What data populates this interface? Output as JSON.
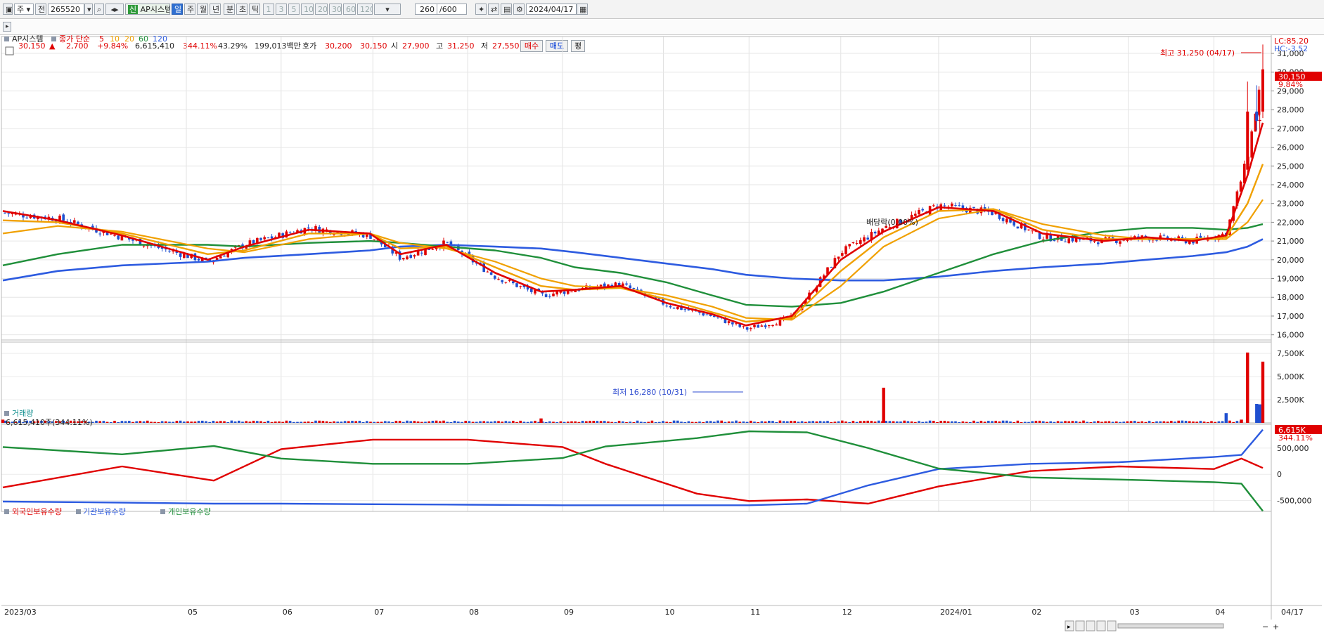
{
  "toolbar": {
    "market": "주",
    "jeon": "전",
    "code": "265520",
    "new_badge": "신",
    "stock_name": "AP시스템",
    "periods": [
      "일",
      "주",
      "월",
      "년",
      "분",
      "초",
      "틱"
    ],
    "active_period": "일",
    "intervals": [
      "1",
      "3",
      "5",
      "10",
      "20",
      "30",
      "60",
      "120"
    ],
    "count": "260",
    "count_total": "/600",
    "date": "2024/04/17"
  },
  "quote": {
    "price": "30,150",
    "arrow": "▲",
    "change": "2,700",
    "rate": "+9.84%",
    "volume": "6,615,410",
    "vol_ratio": "344.11%",
    "turnover": "43.29%",
    "amount": "199,013백만",
    "hoga_label": "호가",
    "ask": "30,200",
    "bid": "30,150",
    "open_label": "시",
    "open": "27,900",
    "high_label": "고",
    "high": "31,250",
    "low_label": "저",
    "low": "27,550",
    "buy_label": "매수",
    "sell_label": "매도",
    "pyeong_label": "평"
  },
  "price_panel": {
    "title": "AP시스템",
    "ma_label": "종가 단순",
    "ma_periods": [
      "5",
      "10",
      "20",
      "60",
      "120"
    ],
    "ma_colors": [
      "#e00000",
      "#f0a000",
      "#f0a000",
      "#1f8f3a",
      "#2d5be0"
    ],
    "lc": "LC:85.20",
    "hc": "HC:-3.52",
    "last_price": "30,150",
    "last_rate": "9.84%",
    "max_note": "최고 31,250 (04/17)",
    "min_note": "최저 16,280 (10/31)",
    "dividend_note": "배당락(0.00%)",
    "y_ticks": [
      "31,000",
      "30,000",
      "29,000",
      "28,000",
      "27,000",
      "26,000",
      "25,000",
      "24,000",
      "23,000",
      "22,000",
      "21,000",
      "20,000",
      "19,000",
      "18,000",
      "17,000",
      "16,000"
    ]
  },
  "volume_panel": {
    "title": "거래량",
    "info": "6,615,410주(344.11%)",
    "last_value": "6,615K",
    "last_rate": "344.11%",
    "y_ticks": [
      "7,500K",
      "5,000K",
      "2,500K"
    ]
  },
  "holdings_panel": {
    "legend": [
      "외국인보유수량",
      "기관보유수량",
      "개인보유수량"
    ],
    "colors": [
      "#e00000",
      "#2d5be0",
      "#1f8f3a"
    ],
    "y_ticks": [
      "500,000",
      "0",
      "-500,000"
    ]
  },
  "x_axis": {
    "labels": [
      "2023/03",
      "05",
      "06",
      "07",
      "08",
      "09",
      "10",
      "11",
      "12",
      "2024/01",
      "02",
      "03",
      "04",
      "04/17"
    ]
  },
  "chart_data": [
    {
      "type": "line",
      "title": "AP시스템",
      "x_range": [
        "2023/03",
        "2024/04/17"
      ],
      "ylim": [
        15800,
        31300
      ],
      "close_price_points": {
        "x": [
          "2023/03/02",
          "2023/03/20",
          "2023/04/10",
          "2023/05/08",
          "2023/05/20",
          "2023/06/10",
          "2023/06/30",
          "2023/07/10",
          "2023/07/25",
          "2023/08/10",
          "2023/08/25",
          "2023/09/05",
          "2023/09/20",
          "2023/10/05",
          "2023/10/20",
          "2023/10/31",
          "2023/11/15",
          "2023/12/01",
          "2023/12/15",
          "2024/01/02",
          "2024/01/20",
          "2024/02/05",
          "2024/02/25",
          "2024/03/10",
          "2024/03/25",
          "2024/04/05",
          "2024/04/12",
          "2024/04/17"
        ],
        "values": [
          22500,
          22200,
          21200,
          19900,
          20800,
          21700,
          21300,
          20100,
          20900,
          19100,
          18100,
          18400,
          18700,
          17600,
          17000,
          16300,
          16900,
          20400,
          21700,
          22900,
          22500,
          21200,
          21000,
          21200,
          21000,
          21400,
          25500,
          30150
        ]
      },
      "series": [
        {
          "name": "5",
          "values": [
            22600,
            22100,
            21300,
            20000,
            20700,
            21600,
            21400,
            20300,
            20800,
            19300,
            18300,
            18400,
            18600,
            17700,
            17100,
            16500,
            17000,
            20000,
            21500,
            22800,
            22600,
            21400,
            21000,
            21200,
            21000,
            21300,
            24500,
            27300
          ]
        },
        {
          "name": "10",
          "values": [
            22100,
            22000,
            21400,
            20300,
            20500,
            21400,
            21400,
            20600,
            20700,
            19600,
            18600,
            18400,
            18500,
            17900,
            17200,
            16700,
            16900,
            19400,
            21200,
            22600,
            22700,
            21600,
            21100,
            21100,
            21100,
            21200,
            23000,
            25100
          ]
        },
        {
          "name": "20",
          "values": [
            21400,
            21800,
            21500,
            20600,
            20400,
            21100,
            21400,
            20900,
            20600,
            19900,
            19000,
            18600,
            18500,
            18100,
            17500,
            16900,
            16800,
            18600,
            20700,
            22200,
            22700,
            21900,
            21300,
            21100,
            21100,
            21100,
            22000,
            23200
          ]
        },
        {
          "name": "60",
          "values": [
            19700,
            20300,
            20800,
            20800,
            20700,
            20900,
            21000,
            20900,
            20700,
            20500,
            20100,
            19600,
            19300,
            18800,
            18100,
            17600,
            17500,
            17700,
            18300,
            19300,
            20300,
            21000,
            21500,
            21700,
            21700,
            21600,
            21700,
            21900
          ]
        },
        {
          "name": "120",
          "values": [
            18900,
            19400,
            19700,
            19900,
            20100,
            20300,
            20500,
            20700,
            20800,
            20700,
            20600,
            20400,
            20100,
            19800,
            19500,
            19200,
            19000,
            18900,
            18900,
            19100,
            19400,
            19600,
            19800,
            20000,
            20200,
            20400,
            20700,
            21100
          ]
        }
      ],
      "annotations": {
        "high": 31250,
        "high_date": "04/17",
        "low": 16280,
        "low_date": "10/31"
      }
    },
    {
      "type": "bar",
      "title": "거래량",
      "ylim": [
        0,
        8500
      ],
      "unit": "K",
      "x": [
        "2023/03/02",
        "2023/08/25",
        "2023/12/15",
        "2024/04/05",
        "2024/04/10",
        "2024/04/12",
        "2024/04/15",
        "2024/04/16",
        "2024/04/17"
      ],
      "values": [
        350,
        480,
        3800,
        1050,
        350,
        7600,
        2050,
        2000,
        6615
      ],
      "baseline": 150
    },
    {
      "type": "line",
      "title": "외국인보유수량 / 기관보유수량 / 개인보유수량",
      "ylim": [
        -600000,
        900000
      ],
      "x": [
        "2023/03/02",
        "2023/04/10",
        "2023/05/10",
        "2023/06/01",
        "2023/07/01",
        "2023/08/01",
        "2023/09/01",
        "2023/09/15",
        "2023/10/15",
        "2023/11/01",
        "2023/11/20",
        "2023/12/10",
        "2024/01/02",
        "2024/02/01",
        "2024/03/01",
        "2024/04/01",
        "2024/04/10",
        "2024/04/17"
      ],
      "series": [
        {
          "name": "외국인보유수량",
          "values": [
            -250000,
            150000,
            -120000,
            480000,
            660000,
            660000,
            520000,
            200000,
            -370000,
            -510000,
            -480000,
            -560000,
            -230000,
            60000,
            150000,
            100000,
            300000,
            120000
          ]
        },
        {
          "name": "기관보유수량",
          "values": [
            -520000,
            -540000,
            -560000,
            -560000,
            -570000,
            -580000,
            -590000,
            -590000,
            -590000,
            -590000,
            -560000,
            -210000,
            100000,
            200000,
            230000,
            330000,
            370000,
            850000
          ]
        },
        {
          "name": "개인보유수량",
          "values": [
            520000,
            380000,
            540000,
            300000,
            200000,
            200000,
            310000,
            530000,
            690000,
            820000,
            800000,
            500000,
            110000,
            -60000,
            -100000,
            -150000,
            -180000,
            -700000
          ]
        }
      ]
    }
  ]
}
